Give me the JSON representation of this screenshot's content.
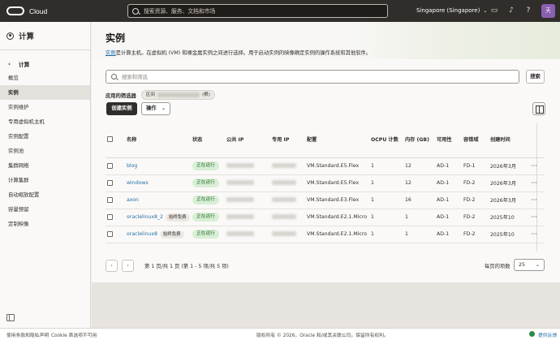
{
  "topbar": {
    "brand": "Cloud",
    "search_placeholder": "搜索资源、服务、文档和市场",
    "region": "Singapore (Singapore)",
    "avatar_initial": "天"
  },
  "sidebar": {
    "title": "计算",
    "section": "计算",
    "items": [
      {
        "label": "概览"
      },
      {
        "label": "实例"
      },
      {
        "label": "实例维护"
      },
      {
        "label": "专用虚拟机主机"
      },
      {
        "label": "实例配置"
      },
      {
        "label": "实例池"
      },
      {
        "label": "集群网络"
      },
      {
        "label": "计算集群"
      },
      {
        "label": "自动缩放配置"
      },
      {
        "label": "容量预留"
      },
      {
        "label": "定制映像"
      }
    ]
  },
  "main": {
    "title": "实例",
    "desc_link": "实例",
    "desc_rest": "是计算主机。在虚拟机 (VM) 和裸金属实例之间进行选择。用于启动实例的映像确定实例的操作系统和其他软件。",
    "filter_placeholder": "搜索和筛选",
    "search_button": "搜索",
    "applied_filters_label": "应用的筛选器",
    "chip_prefix": "区间",
    "chip_suffix": "(根)",
    "create_button": "创建实例",
    "actions_button": "操作",
    "columns": [
      "名称",
      "状态",
      "公共 IP",
      "专用 IP",
      "配置",
      "OCPU 计数",
      "内存 (GB)",
      "可用性",
      "容错域",
      "创建时间"
    ],
    "rows": [
      {
        "name": "blog",
        "tag": "",
        "status": "正在运行",
        "shape": "VM.Standard.E5.Flex",
        "ocpu": "1",
        "memory": "12",
        "ad": "AD-1",
        "fd": "FD-1",
        "created": "2026年3月"
      },
      {
        "name": "windows",
        "tag": "",
        "status": "正在运行",
        "shape": "VM.Standard.E5.Flex",
        "ocpu": "1",
        "memory": "12",
        "ad": "AD-1",
        "fd": "FD-2",
        "created": "2026年3月"
      },
      {
        "name": "axon",
        "tag": "",
        "status": "正在运行",
        "shape": "VM.Standard.E3.Flex",
        "ocpu": "1",
        "memory": "16",
        "ad": "AD-1",
        "fd": "FD-2",
        "created": "2026年3月"
      },
      {
        "name": "oraclelinux8_2",
        "tag": "始终免费",
        "status": "正在运行",
        "shape": "VM.Standard.E2.1.Micro",
        "ocpu": "1",
        "memory": "1",
        "ad": "AD-1",
        "fd": "FD-2",
        "created": "2025年10"
      },
      {
        "name": "oraclelinux8",
        "tag": "始终免费",
        "status": "正在运行",
        "shape": "VM.Standard.E2.1.Micro",
        "ocpu": "1",
        "memory": "1",
        "ad": "AD-1",
        "fd": "FD-2",
        "created": "2025年10"
      }
    ],
    "pager": {
      "info": "第 1 页/共 1 页 (第 1 - 5 项/共 5 项)",
      "page_size_label": "每页的项数",
      "page_size": "25"
    }
  },
  "footer": {
    "terms": "使用条款和隐私声明",
    "cookie": "Cookie 首选项不可用",
    "copyright": "版权所有 © 2026，Oracle 和/或其关联公司。保留所有权利。",
    "feedback": "提供反馈"
  },
  "colors": {
    "topbar": "#312d2a",
    "link": "#1f6fa8",
    "status_bg": "#d7efd4",
    "status_text": "#25632a",
    "primary_button": "#312d2a"
  }
}
